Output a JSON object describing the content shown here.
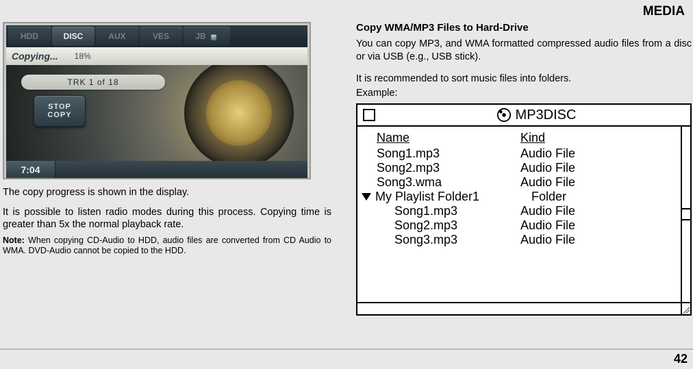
{
  "header": {
    "title": "MEDIA"
  },
  "screenshot": {
    "tabs": [
      "HDD",
      "DISC",
      "AUX",
      "VES",
      "JB"
    ],
    "active_tab_index": 1,
    "status_text": "Copying...",
    "progress_pct": "18%",
    "track_text": "TRK  1 of 18",
    "stop_line1": "STOP",
    "stop_line2": "COPY",
    "clock": "7:04"
  },
  "left": {
    "p1": "The copy progress is shown in the display.",
    "p2": "It is possible to listen radio modes during this process. Copying time is greater than 5x the normal playback rate.",
    "note_label": "Note:",
    "note_text": " When copying CD-Audio to HDD, audio files are converted from CD Audio to WMA. DVD-Audio cannot be copied to the HDD."
  },
  "right": {
    "heading": "Copy WMA/MP3 Files to Hard-Drive",
    "p1": "You can copy MP3, and WMA formatted compressed audio files from a disc or via USB (e.g., USB stick).",
    "p2": "It is recommended to sort music files into folders.",
    "example_label": "Example:"
  },
  "listing": {
    "title": "MP3DISC",
    "headers": {
      "name": "Name",
      "kind": "Kind"
    },
    "rows": [
      {
        "name": "Song1.mp3",
        "kind": "Audio File",
        "indent": 0
      },
      {
        "name": "Song2.mp3",
        "kind": "Audio File",
        "indent": 0
      },
      {
        "name": "Song3.wma",
        "kind": "Audio File",
        "indent": 0
      }
    ],
    "folder": {
      "name": "My Playlist Folder1",
      "kind": "Folder"
    },
    "subrows": [
      {
        "name": "Song1.mp3",
        "kind": "Audio File"
      },
      {
        "name": "Song2.mp3",
        "kind": "Audio File"
      },
      {
        "name": "Song3.mp3",
        "kind": "Audio File"
      }
    ]
  },
  "page_number": "42"
}
